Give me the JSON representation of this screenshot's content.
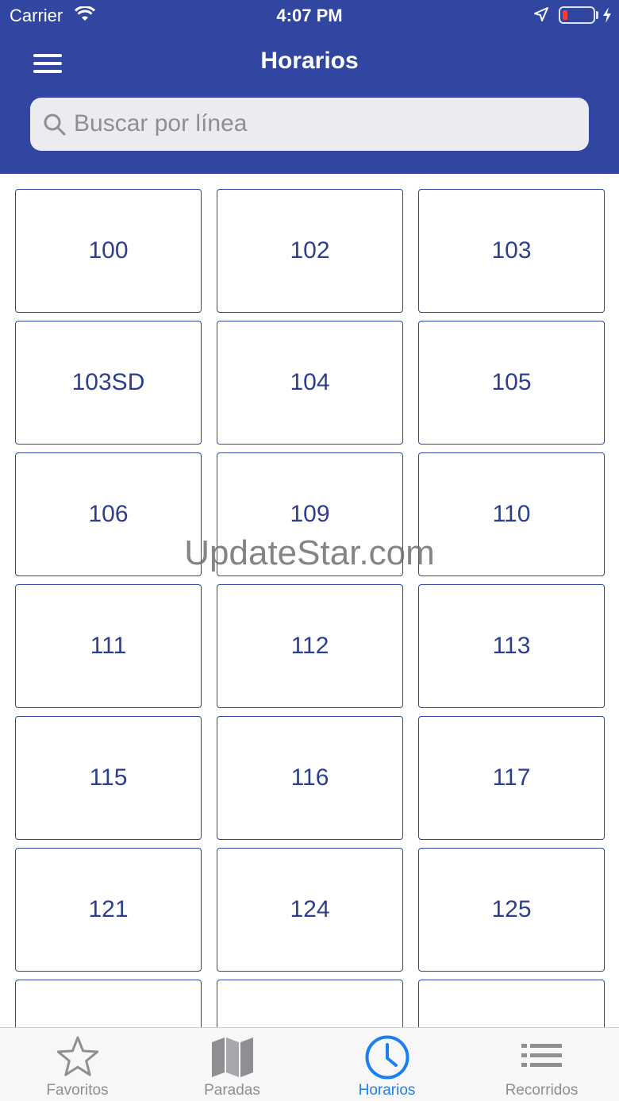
{
  "status_bar": {
    "carrier": "Carrier",
    "time": "4:07 PM"
  },
  "header": {
    "title": "Horarios"
  },
  "search": {
    "placeholder": "Buscar por línea",
    "value": ""
  },
  "lines": [
    "100",
    "102",
    "103",
    "103SD",
    "104",
    "105",
    "106",
    "109",
    "110",
    "111",
    "112",
    "113",
    "115",
    "116",
    "117",
    "121",
    "124",
    "125",
    "",
    "",
    ""
  ],
  "watermark": "UpdateStar.com",
  "tabs": [
    {
      "label": "Favoritos",
      "icon": "star-icon",
      "active": false
    },
    {
      "label": "Paradas",
      "icon": "map-icon",
      "active": false
    },
    {
      "label": "Horarios",
      "icon": "clock-icon",
      "active": true
    },
    {
      "label": "Recorridos",
      "icon": "list-icon",
      "active": false
    }
  ],
  "colors": {
    "header": "#3046a0",
    "tile_border": "#3046a0",
    "tile_text": "#2d3e8f",
    "tab_active": "#1a7ff2",
    "tab_inactive": "#8e8e93"
  }
}
